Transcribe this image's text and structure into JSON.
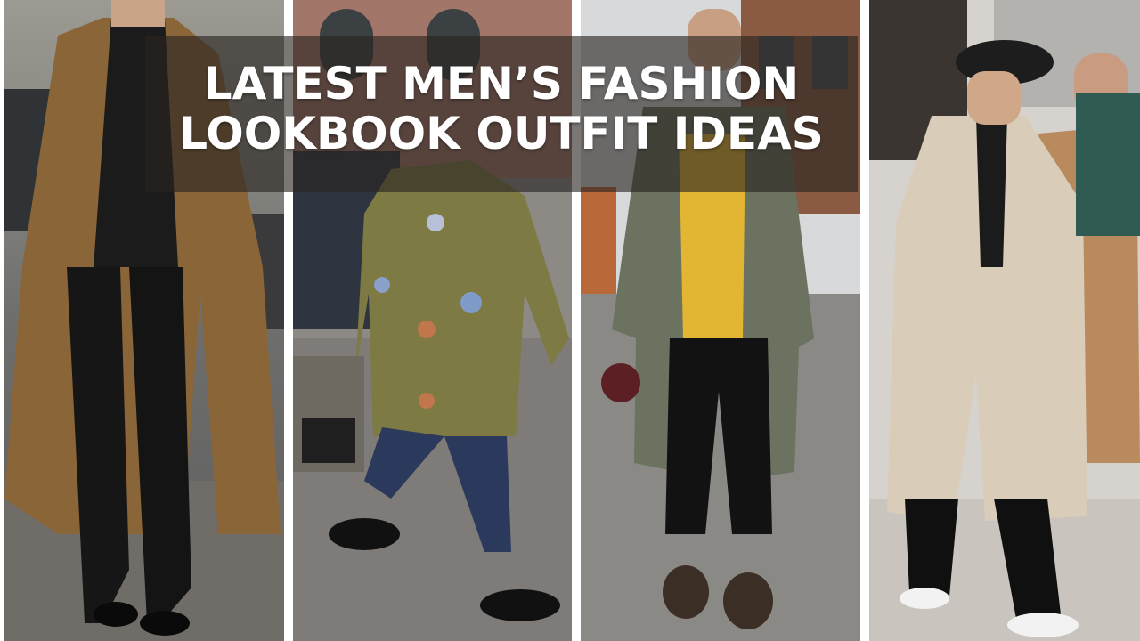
{
  "headline": {
    "line1": "LATEST MEN’S FASHION",
    "line2": "LOOKBOOK OUTFIT IDEAS"
  },
  "photos": [
    {
      "subject": "man in camel trench coat over black turtleneck"
    },
    {
      "subject": "man in olive coat with butterfly patches pulling luggage"
    },
    {
      "subject": "man in grey-green parka over yellow shirt"
    },
    {
      "subject": "man in beret and beige overcoat"
    }
  ],
  "colors": {
    "overlay": "#28241f",
    "title_text": "#ffffff",
    "camel_coat": "#8a6538",
    "olive_coat": "#7d7a44",
    "sage_coat": "#6b7260",
    "yellow_shirt": "#e2b532",
    "beige_coat": "#d9ccb8"
  }
}
